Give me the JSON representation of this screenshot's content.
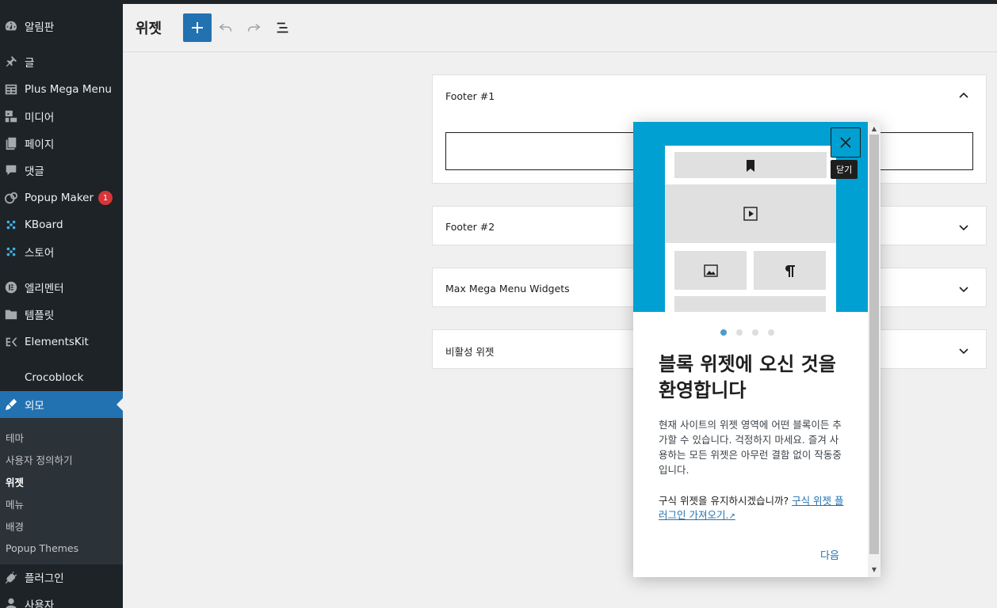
{
  "sidebar": {
    "items": [
      {
        "label": "알림판",
        "icon": "dashboard-icon"
      },
      {
        "label": "글",
        "icon": "pin-icon"
      },
      {
        "label": "Plus Mega Menu",
        "icon": "table-icon"
      },
      {
        "label": "미디어",
        "icon": "media-icon"
      },
      {
        "label": "페이지",
        "icon": "page-icon"
      },
      {
        "label": "댓글",
        "icon": "comment-icon"
      },
      {
        "label": "Popup Maker",
        "icon": "popup-icon",
        "badge": "1"
      },
      {
        "label": "KBoard",
        "icon": "kboard-icon"
      },
      {
        "label": "스토어",
        "icon": "store-icon"
      },
      {
        "label": "엘리멘터",
        "icon": "elementor-icon"
      },
      {
        "label": "템플릿",
        "icon": "folder-icon"
      },
      {
        "label": "ElementsKit",
        "icon": "elementskit-icon"
      },
      {
        "label": "Crocoblock",
        "icon": ""
      },
      {
        "label": "외모",
        "icon": "brush-icon"
      },
      {
        "label": "플러그인",
        "icon": "plugin-icon"
      },
      {
        "label": "사용자",
        "icon": "user-icon"
      }
    ],
    "submenu": [
      "테마",
      "사용자 정의하기",
      "위젯",
      "메뉴",
      "배경",
      "Popup Themes"
    ]
  },
  "header": {
    "title": "위젯"
  },
  "widget_areas": [
    "Footer #1",
    "Footer #2",
    "Max Mega Menu Widgets",
    "비활성 위젯"
  ],
  "modal": {
    "close_tooltip": "닫기",
    "title": "블록 위젯에 오신 것을 환영합니다",
    "body": "현재 사이트의 위젯 영역에 어떤 블록이든 추가할 수 있습니다. 걱정하지 마세요. 즐겨 사용하는 모든 위젯은 아무런 결함 없이 작동중입니다.",
    "legacy_question": "구식 위젯을 유지하시겠습니까?",
    "legacy_link": "구식 위젯 플러그인 가져오기.",
    "next": "다음",
    "step": 1,
    "steps": 4
  },
  "colors": {
    "sidebar_bg": "#1d2327",
    "accent": "#2271b1",
    "hero_bg": "#00a0d2",
    "badge": "#d63638"
  }
}
